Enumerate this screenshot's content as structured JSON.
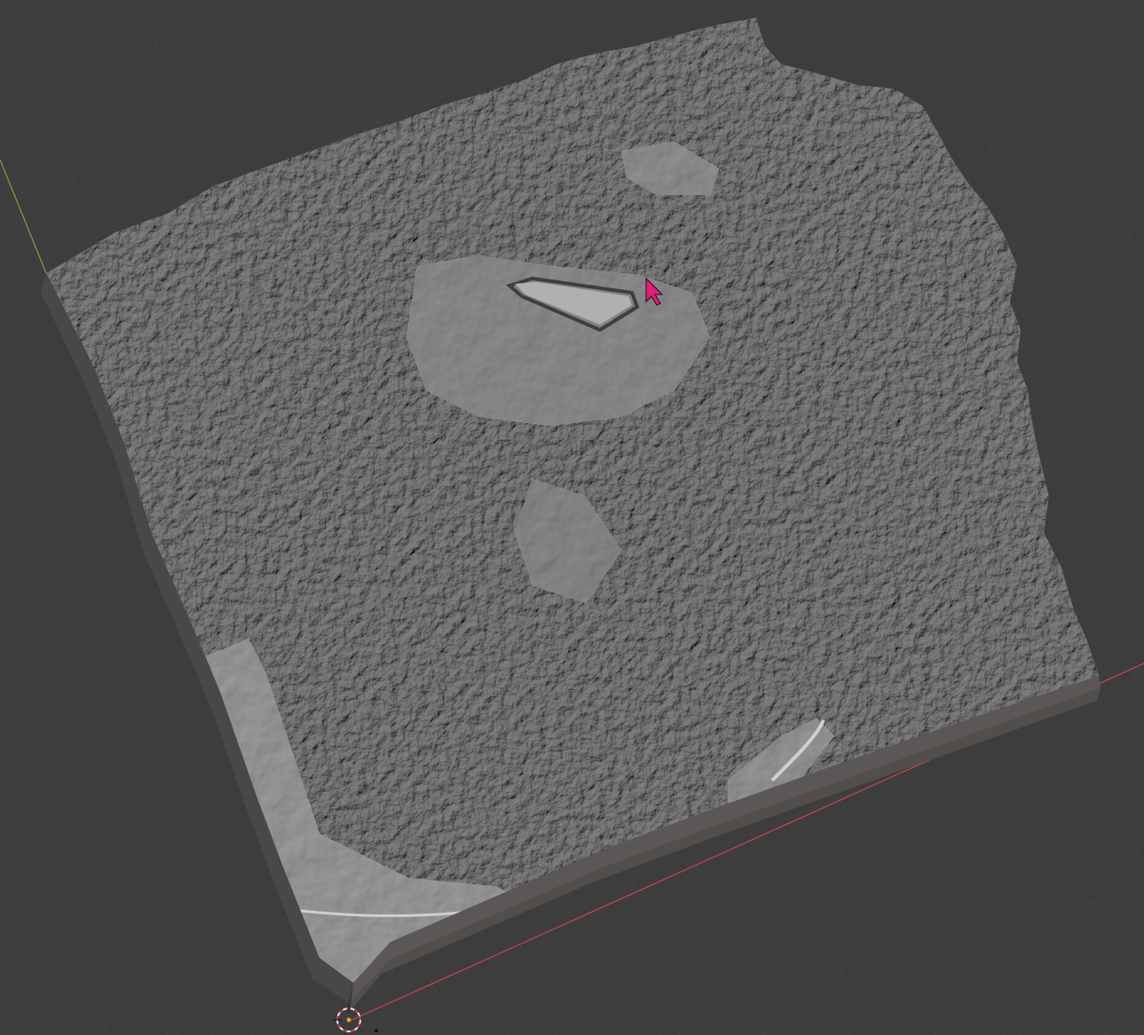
{
  "viewport": {
    "background_color": "#3d3d3d",
    "grid_color": "#474747",
    "x_axis_color": "#c8454f",
    "y_axis_color": "#7da33f"
  },
  "model": {
    "terrain_color": "#9c9c9c",
    "terrain_highlight_color": "#c4c4c4",
    "terrain_shadow_color": "#6a6a6a",
    "base_side_color": "#5a5756",
    "base_bottom_side_color": "#4a4846"
  },
  "cursor": {
    "icon": "mouse-pointer-icon",
    "color": "#e0207a"
  },
  "origin": {
    "icon": "3d-cursor-icon",
    "ring_color_a": "#d03a3a",
    "ring_color_b": "#e8e8e8"
  }
}
